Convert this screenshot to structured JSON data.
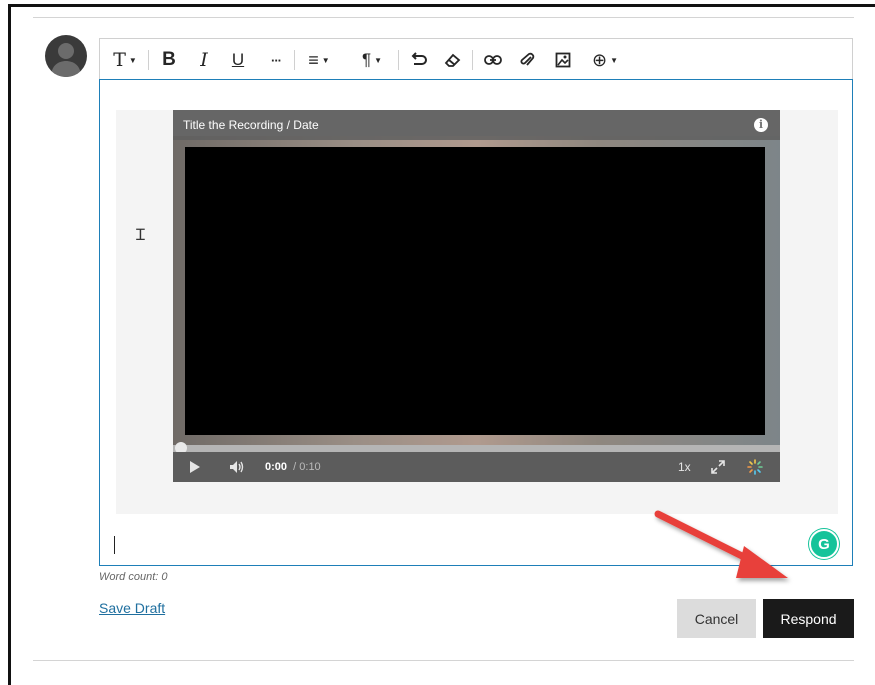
{
  "toolbar": {
    "items": [
      {
        "name": "text-style-icon",
        "glyph": "T"
      },
      {
        "name": "bold-icon",
        "glyph": "B"
      },
      {
        "name": "italic-icon",
        "glyph": "I"
      },
      {
        "name": "underline-icon",
        "glyph": "U"
      },
      {
        "name": "more-icon",
        "glyph": "···"
      },
      {
        "name": "align-icon",
        "glyph": "≡"
      },
      {
        "name": "paragraph-icon",
        "glyph": "¶"
      },
      {
        "name": "undo-icon",
        "glyph": "⤺"
      },
      {
        "name": "eraser-icon",
        "glyph": "⌫"
      },
      {
        "name": "link-icon",
        "glyph": "⊖"
      },
      {
        "name": "attach-icon",
        "glyph": "⌁"
      },
      {
        "name": "image-icon",
        "glyph": "▣"
      },
      {
        "name": "add-content-icon",
        "glyph": "⊕"
      }
    ]
  },
  "video": {
    "title": "Title the Recording / Date",
    "current_time": "0:00",
    "duration": "/ 0:10",
    "speed": "1x",
    "progress": 0
  },
  "footer": {
    "word_count": "Word count: 0",
    "save_draft": "Save Draft",
    "cancel": "Cancel",
    "respond": "Respond"
  },
  "colors": {
    "editor_border": "#1e7fb8",
    "respond_bg": "#1a1a1a",
    "grammarly": "#15c39a",
    "arrow": "#e8413a"
  }
}
